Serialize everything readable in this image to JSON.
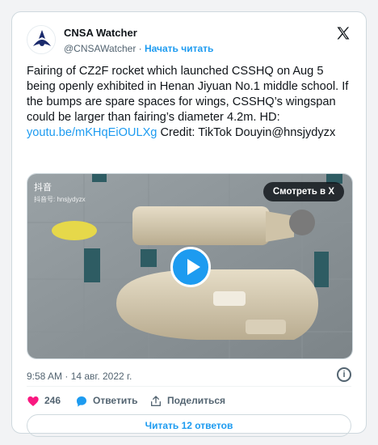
{
  "author": {
    "name": "CNSA Watcher",
    "handle": "@CNSAWatcher",
    "separator": "·",
    "follow_label": "Начать читать"
  },
  "tweet": {
    "text_main": "Fairing of CZ2F rocket which launched CSSHQ on Aug 5 being openly exhibited in Henan Jiyuan No.1 middle school. If the bumps are spare spaces for wings, CSSHQ’s wingspan could be larger than fairing’s diameter 4.2m. HD: ",
    "link_text": "youtu.be/mKHqEiOULXg",
    "text_after": " Credit: TikTok Douyin@hnsjydyzx"
  },
  "media": {
    "watch_label": "Смотреть в X",
    "douyin_label": "抖音",
    "douyin_id": "抖音号: hnsjydyzx"
  },
  "timestamp": "9:58 AM · 14 авг. 2022 г.",
  "actions": {
    "likes": "246",
    "reply_label": "Ответить",
    "share_label": "Поделиться"
  },
  "replies_button": "Читать 12 ответов",
  "colors": {
    "accent": "#1d9bf0",
    "like": "#f91880"
  }
}
